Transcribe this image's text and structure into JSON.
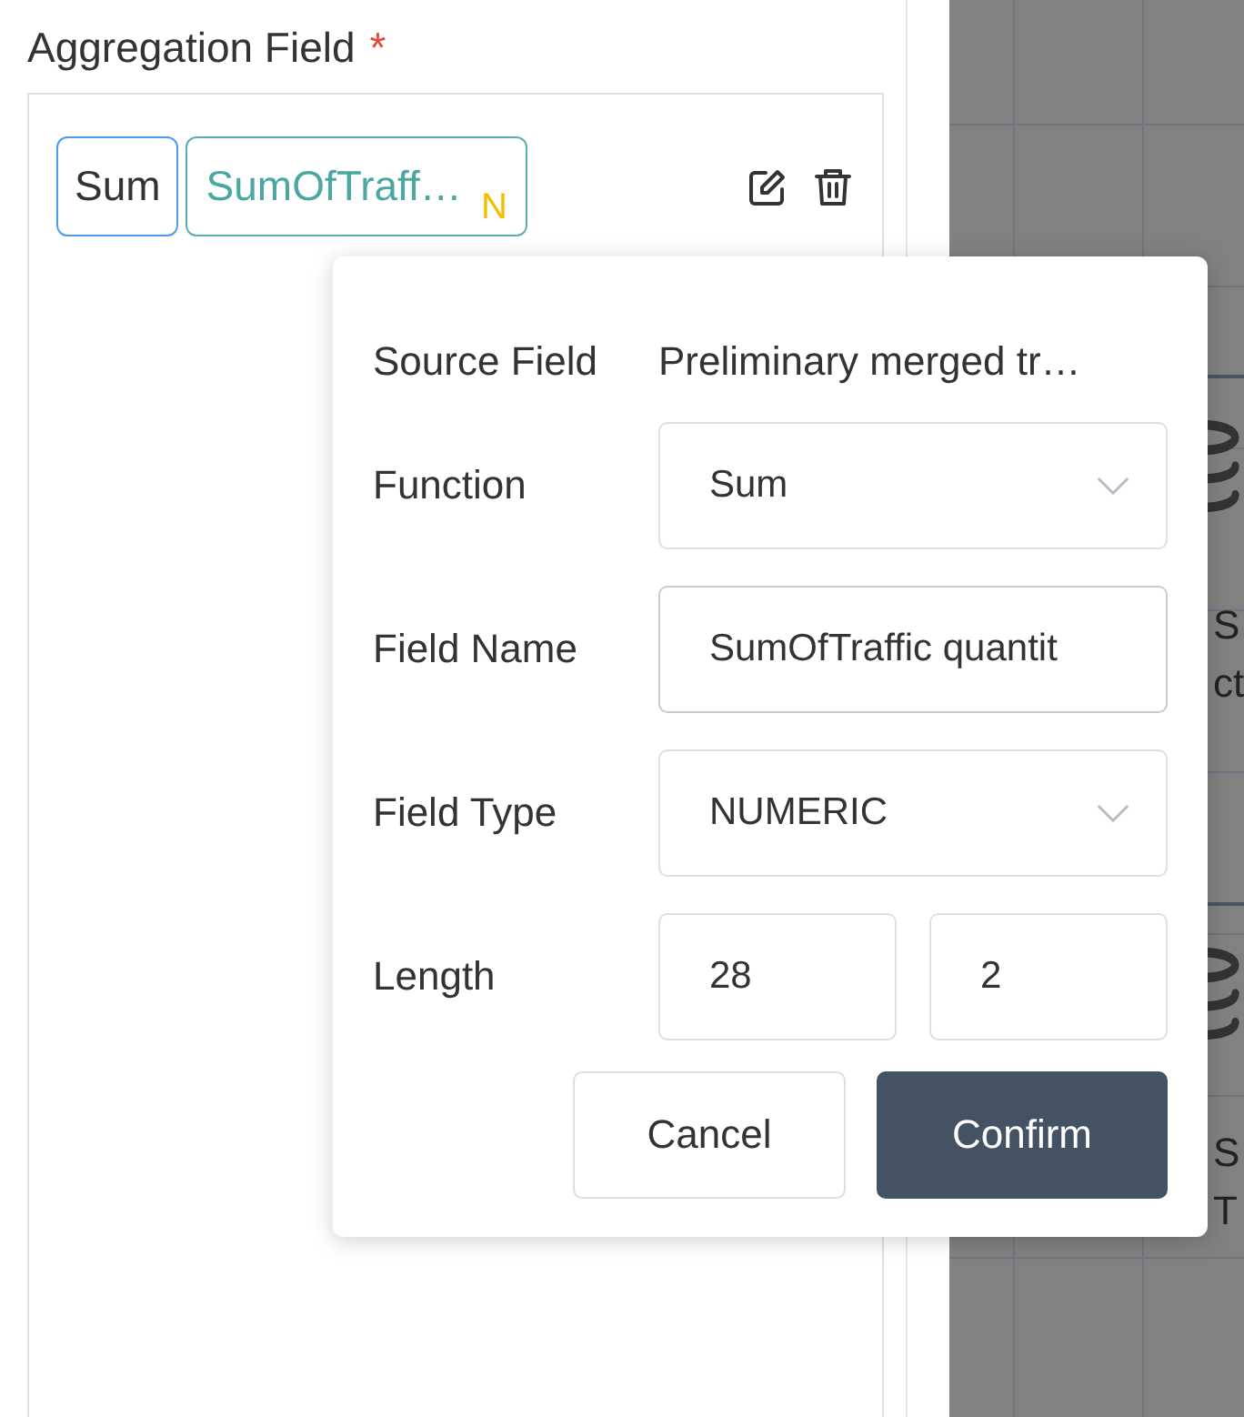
{
  "section": {
    "title": "Aggregation Field",
    "required_mark": "*"
  },
  "aggregations": [
    {
      "function_tag": "Sum",
      "field_tag": "SumOfTraff…",
      "type_badge": "N"
    }
  ],
  "canvas": {
    "nodes": [
      {
        "texts": [
          "S",
          "ct"
        ]
      },
      {
        "texts": [
          "S",
          "T"
        ]
      }
    ]
  },
  "popup": {
    "source_field": {
      "label": "Source Field",
      "value": "Preliminary merged tr…"
    },
    "fields": [
      {
        "kind": "select",
        "label": "Function",
        "value": "Sum"
      },
      {
        "kind": "input",
        "label": "Field Name",
        "value": "SumOfTraffic quantit"
      },
      {
        "kind": "select",
        "label": "Field Type",
        "value": "NUMERIC"
      },
      {
        "kind": "pair",
        "label": "Length",
        "values": [
          "28",
          "2"
        ]
      }
    ],
    "buttons": [
      {
        "kind": "secondary",
        "label": "Cancel"
      },
      {
        "kind": "primary",
        "label": "Confirm"
      }
    ]
  }
}
